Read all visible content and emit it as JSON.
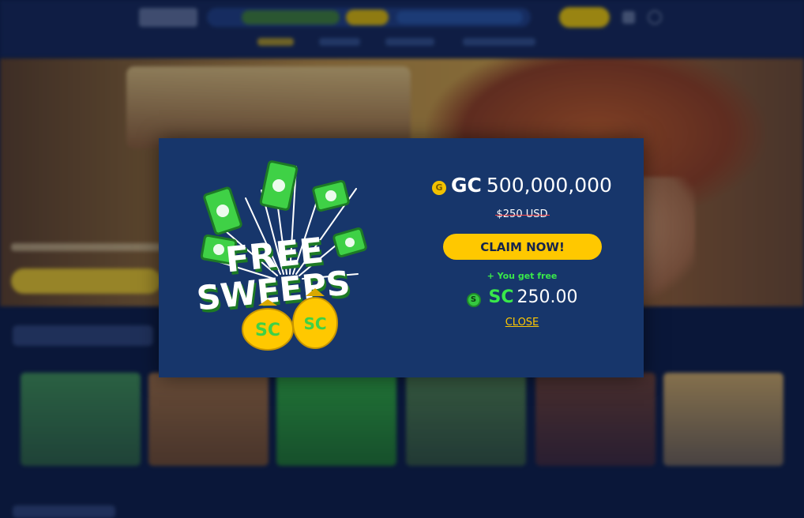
{
  "modal": {
    "amount_currency": "GC",
    "amount_value": "500,000,000",
    "gc_coin_letter": "G",
    "old_price": "$250 USD",
    "claim_label": "CLAIM NOW!",
    "free_note": "+ You get free",
    "bonus_currency": "SC",
    "bonus_value": "250.00",
    "sc_coin_letter": "S",
    "close_label": "CLOSE"
  },
  "promo_art": {
    "line1": "FREE",
    "line2": "SWEEPS",
    "bag_label": "SC"
  },
  "colors": {
    "modal_bg": "#17366b",
    "accent_yellow": "#ffc800",
    "accent_green": "#39e84a",
    "strike_red": "#ff4b4b",
    "page_bg": "#0c1a3c"
  }
}
